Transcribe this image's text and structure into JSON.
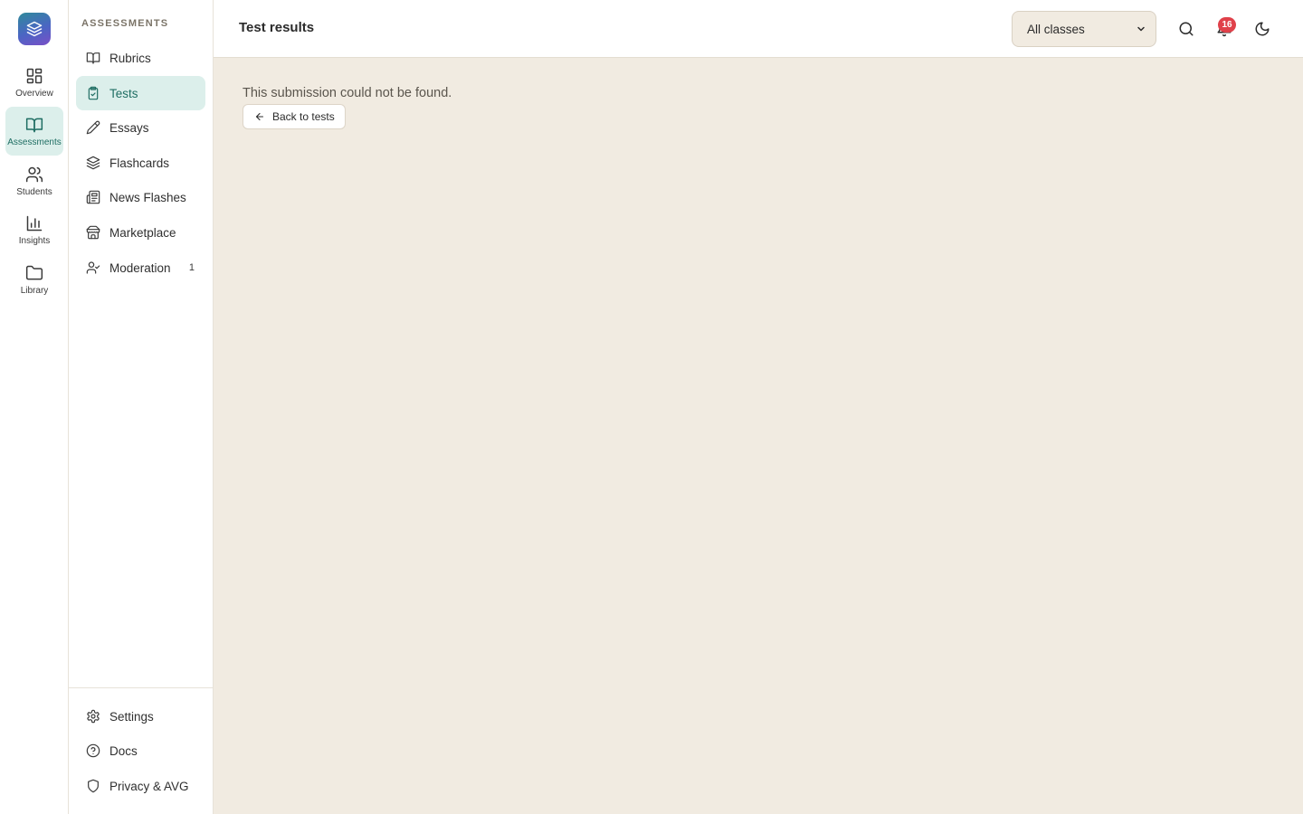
{
  "rail": {
    "items": [
      {
        "label": "Overview",
        "icon": "layout-grid-icon"
      },
      {
        "label": "Assessments",
        "icon": "book-open-icon",
        "active": true
      },
      {
        "label": "Students",
        "icon": "users-icon"
      },
      {
        "label": "Insights",
        "icon": "bar-chart-icon"
      },
      {
        "label": "Library",
        "icon": "folder-icon"
      }
    ]
  },
  "panel": {
    "heading": "ASSESSMENTS",
    "items": [
      {
        "label": "Rubrics",
        "icon": "book-open-icon"
      },
      {
        "label": "Tests",
        "icon": "clipboard-check-icon",
        "active": true
      },
      {
        "label": "Essays",
        "icon": "pencil-icon"
      },
      {
        "label": "Flashcards",
        "icon": "layers-icon"
      },
      {
        "label": "News Flashes",
        "icon": "newspaper-icon"
      },
      {
        "label": "Marketplace",
        "icon": "store-icon"
      },
      {
        "label": "Moderation",
        "icon": "user-check-icon",
        "count": "1"
      }
    ],
    "footer": [
      {
        "label": "Settings",
        "icon": "gear-icon"
      },
      {
        "label": "Docs",
        "icon": "help-circle-icon"
      },
      {
        "label": "Privacy & AVG",
        "icon": "shield-icon"
      }
    ]
  },
  "header": {
    "title": "Test results",
    "class_filter": {
      "value": "All classes"
    },
    "notifications_count": "16"
  },
  "main": {
    "message": "This submission could not be found.",
    "back_label": "Back to tests"
  },
  "colors": {
    "accent": "#1f6e63",
    "active_bg": "#dcefeb",
    "page_bg": "#f1ebe1",
    "badge": "#e0414a"
  }
}
